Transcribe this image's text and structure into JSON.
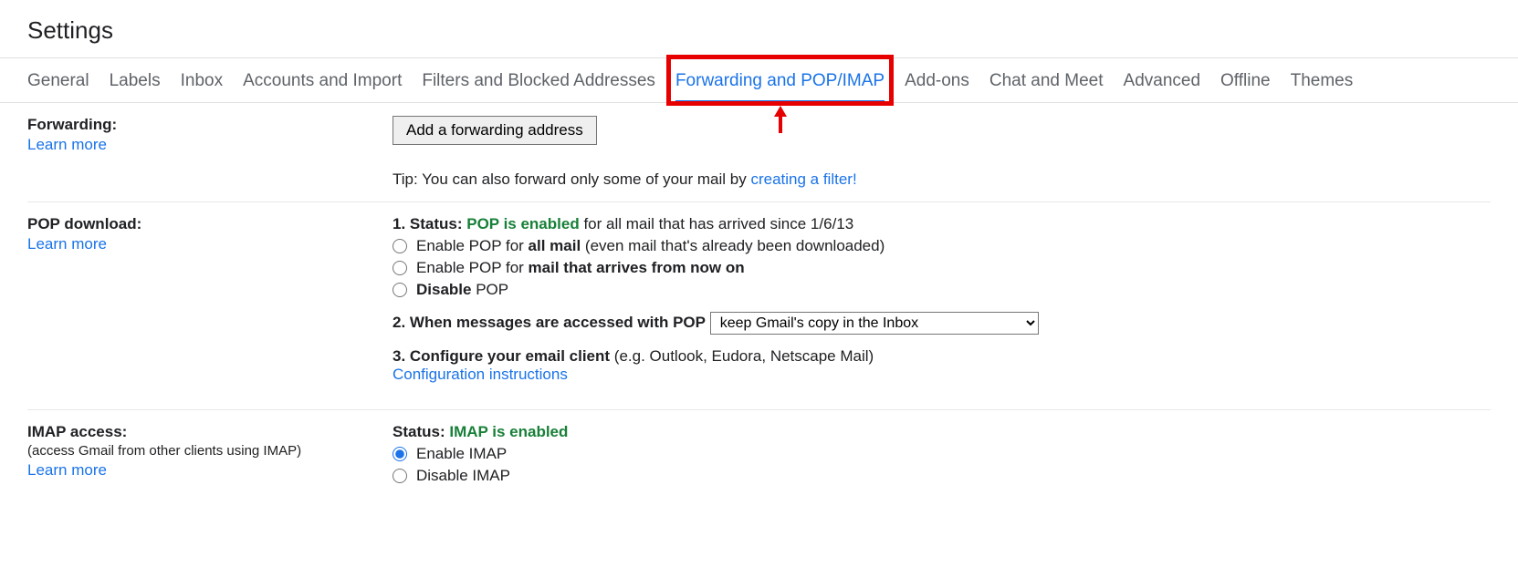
{
  "page_title": "Settings",
  "tabs": [
    "General",
    "Labels",
    "Inbox",
    "Accounts and Import",
    "Filters and Blocked Addresses",
    "Forwarding and POP/IMAP",
    "Add-ons",
    "Chat and Meet",
    "Advanced",
    "Offline",
    "Themes"
  ],
  "active_tab_index": 5,
  "forwarding": {
    "title": "Forwarding:",
    "learn_more": "Learn more",
    "add_btn": "Add a forwarding address",
    "tip_prefix": "Tip: You can also forward only some of your mail by ",
    "tip_link": "creating a filter!"
  },
  "pop": {
    "title": "POP download:",
    "learn_more": "Learn more",
    "status_prefix": "1. Status: ",
    "status_green": "POP is enabled",
    "status_suffix": " for all mail that has arrived since 1/6/13",
    "opt1_a": "Enable POP for ",
    "opt1_b": "all mail",
    "opt1_c": " (even mail that's already been downloaded)",
    "opt2_a": "Enable POP for ",
    "opt2_b": "mail that arrives from now on",
    "opt3_a": "Disable",
    "opt3_b": " POP",
    "q2_label": "2. When messages are accessed with POP",
    "q2_selected": "keep Gmail's copy in the Inbox",
    "q3_bold": "3. Configure your email client",
    "q3_rest": " (e.g. Outlook, Eudora, Netscape Mail)",
    "q3_link": "Configuration instructions"
  },
  "imap": {
    "title": "IMAP access:",
    "sub": "(access Gmail from other clients using IMAP)",
    "learn_more": "Learn more",
    "status_prefix": "Status: ",
    "status_green": "IMAP is enabled",
    "opt_enable": "Enable IMAP",
    "opt_disable": "Disable IMAP"
  }
}
